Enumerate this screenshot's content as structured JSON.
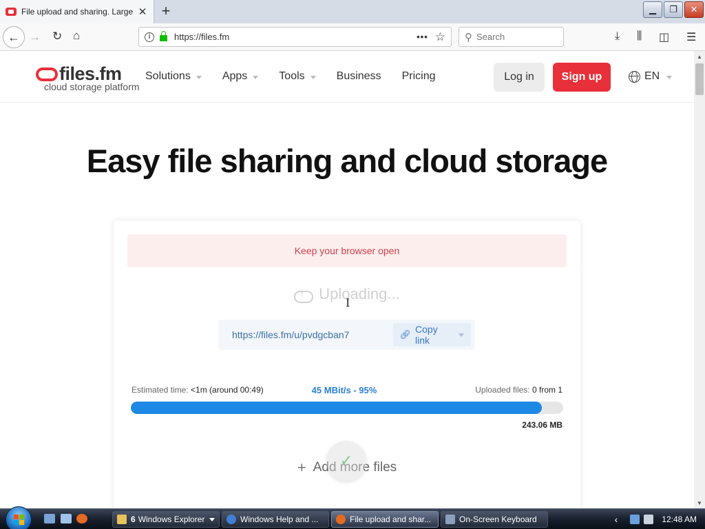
{
  "browser": {
    "tab_title": "File upload and sharing. Large f",
    "tab_close": "✕",
    "new_tab": "+",
    "url": "https://files.fm",
    "url_actions": "•••",
    "search_placeholder": "Search",
    "window_controls": {
      "minimize": "▁",
      "restore": "❐",
      "close": "✕"
    },
    "icons": {
      "back": "back-arrow-icon",
      "forward": "forward-arrow-icon",
      "reload": "reload-icon",
      "home": "home-icon",
      "download": "download-icon",
      "library": "library-icon",
      "sidebar": "sidebar-icon",
      "menu": "hamburger-menu-icon"
    }
  },
  "site": {
    "logo_name": "files.fm",
    "logo_tagline": "cloud storage platform",
    "nav": [
      {
        "label": "Solutions",
        "has_dropdown": true
      },
      {
        "label": "Apps",
        "has_dropdown": true
      },
      {
        "label": "Tools",
        "has_dropdown": true
      },
      {
        "label": "Business",
        "has_dropdown": false
      },
      {
        "label": "Pricing",
        "has_dropdown": false
      }
    ],
    "login_label": "Log in",
    "signup_label": "Sign up",
    "language": "EN",
    "colors": {
      "brand_red": "#e8303a",
      "progress_blue": "#1e88e5",
      "link_blue": "#3b6fa8"
    }
  },
  "hero": {
    "title": "Easy file sharing and cloud storage"
  },
  "upload": {
    "alert": "Keep your browser open",
    "status": "Uploading...",
    "share_url": "https://files.fm/u/pvdgcban7",
    "copy_label": "Copy link",
    "eta_label": "Estimated time:",
    "eta_value": "<1m (around 00:49)",
    "speed": "45 MBit/s - 95%",
    "files_label": "Uploaded files:",
    "files_value": "0 from 1",
    "progress_percent": 95,
    "size": "243.06 MB",
    "add_more": "Add more files"
  },
  "taskbar": {
    "items": [
      {
        "label": "Windows Explorer",
        "count": "6",
        "has_menu": true
      },
      {
        "label": "Windows Help and ...",
        "count": "",
        "has_menu": false
      },
      {
        "label": "File upload and shar...",
        "count": "",
        "has_menu": false,
        "active": true
      },
      {
        "label": "On-Screen Keyboard",
        "count": "",
        "has_menu": false
      }
    ],
    "tray_chevron": "‹",
    "clock": "12:48 AM"
  }
}
